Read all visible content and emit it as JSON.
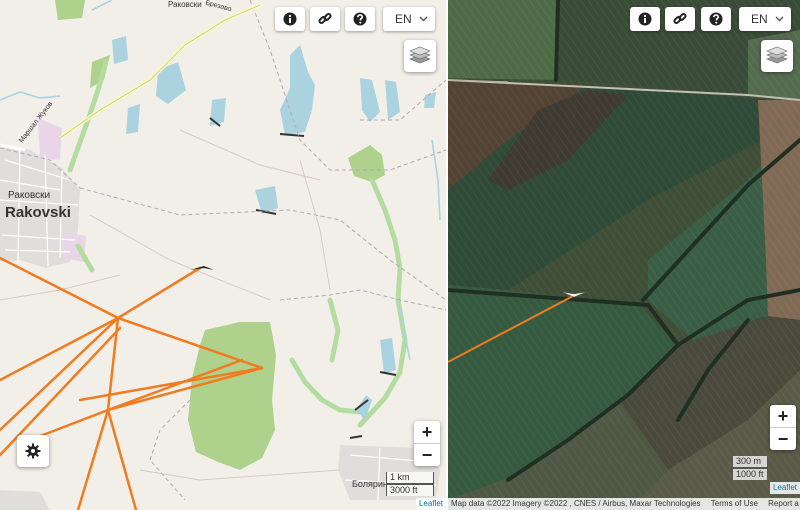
{
  "left_map": {
    "places": {
      "town_cyr": "Раковски",
      "town_lat": "Rakovski",
      "road_cyr": "Маршал Жуков",
      "north_cyr": "Раковски",
      "north2_cyr": "Брезово",
      "south_cyr": "Болярин"
    },
    "scale": {
      "metric": "1 km",
      "imperial": "3000 ft"
    },
    "attribution": "Leaflet"
  },
  "right_map": {
    "scale": {
      "metric": "300 m",
      "imperial": "1000 ft"
    },
    "attribution_top": "Leaflet",
    "attribution": {
      "data": "Map data ©2022 Imagery ©2022 , CNES / Airbus, Maxar Technologies",
      "terms": "Terms of Use",
      "report": "Report a map error"
    }
  },
  "toolbar": {
    "language": "EN",
    "zoom_in": "+",
    "zoom_out": "−"
  },
  "icons": [
    "info-icon",
    "link-icon",
    "help-icon",
    "chevron-down-icon",
    "layers-icon",
    "gear-icon",
    "plane-icon"
  ],
  "colors": {
    "track": "#f07b20",
    "park": "#a9d08e",
    "water": "#aad3df",
    "town": "#dddddd"
  }
}
